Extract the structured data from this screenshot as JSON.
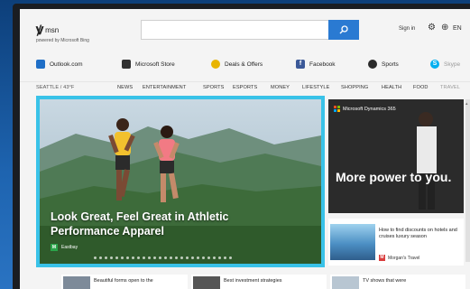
{
  "header": {
    "logo_text": "msn",
    "logo_sub": "powered by Microsoft Bing",
    "search_placeholder": "",
    "sign_in": "Sign in",
    "lang": "EN"
  },
  "quick_links": [
    {
      "label": "Outlook.com",
      "icon": "outlook-icon",
      "color": "#1f6fc7"
    },
    {
      "label": "Microsoft Store",
      "icon": "store-icon",
      "color": "#333333"
    },
    {
      "label": "Deals & Offers",
      "icon": "tag-icon",
      "color": "#e8b400"
    },
    {
      "label": "Facebook",
      "icon": "facebook-icon",
      "color": "#3b5998"
    },
    {
      "label": "Sports",
      "icon": "sports-icon",
      "color": "#2a2a2a"
    },
    {
      "label": "Skype",
      "icon": "skype-icon",
      "color": "#00aff0"
    }
  ],
  "nav": {
    "location": "SEATTLE / 43°F",
    "items": [
      "NEWS",
      "ENTERTAINMENT",
      "SPORTS",
      "ESPORTS",
      "MONEY",
      "LIFESTYLE",
      "SHOPPING",
      "HEALTH",
      "FOOD",
      "TRAVEL"
    ]
  },
  "hero": {
    "title": "Look Great, Feel Great in Athletic Performance Apparel",
    "source": "Eastbay",
    "source_badge": "M"
  },
  "ad": {
    "brand": "Microsoft Dynamics 365",
    "text": "More power to you."
  },
  "news_card": {
    "title": "How to find discounts on hotels and cruises luxury season",
    "source": "Morgan's Travel",
    "source_badge": "M"
  },
  "bottom_row": [
    {
      "title": "Beautiful forms open to the"
    },
    {
      "title": "Best investment strategies"
    },
    {
      "title": "TV shows that were"
    }
  ],
  "colors": {
    "accent": "#2a7ad2",
    "hero_border": "#39c2e8"
  }
}
